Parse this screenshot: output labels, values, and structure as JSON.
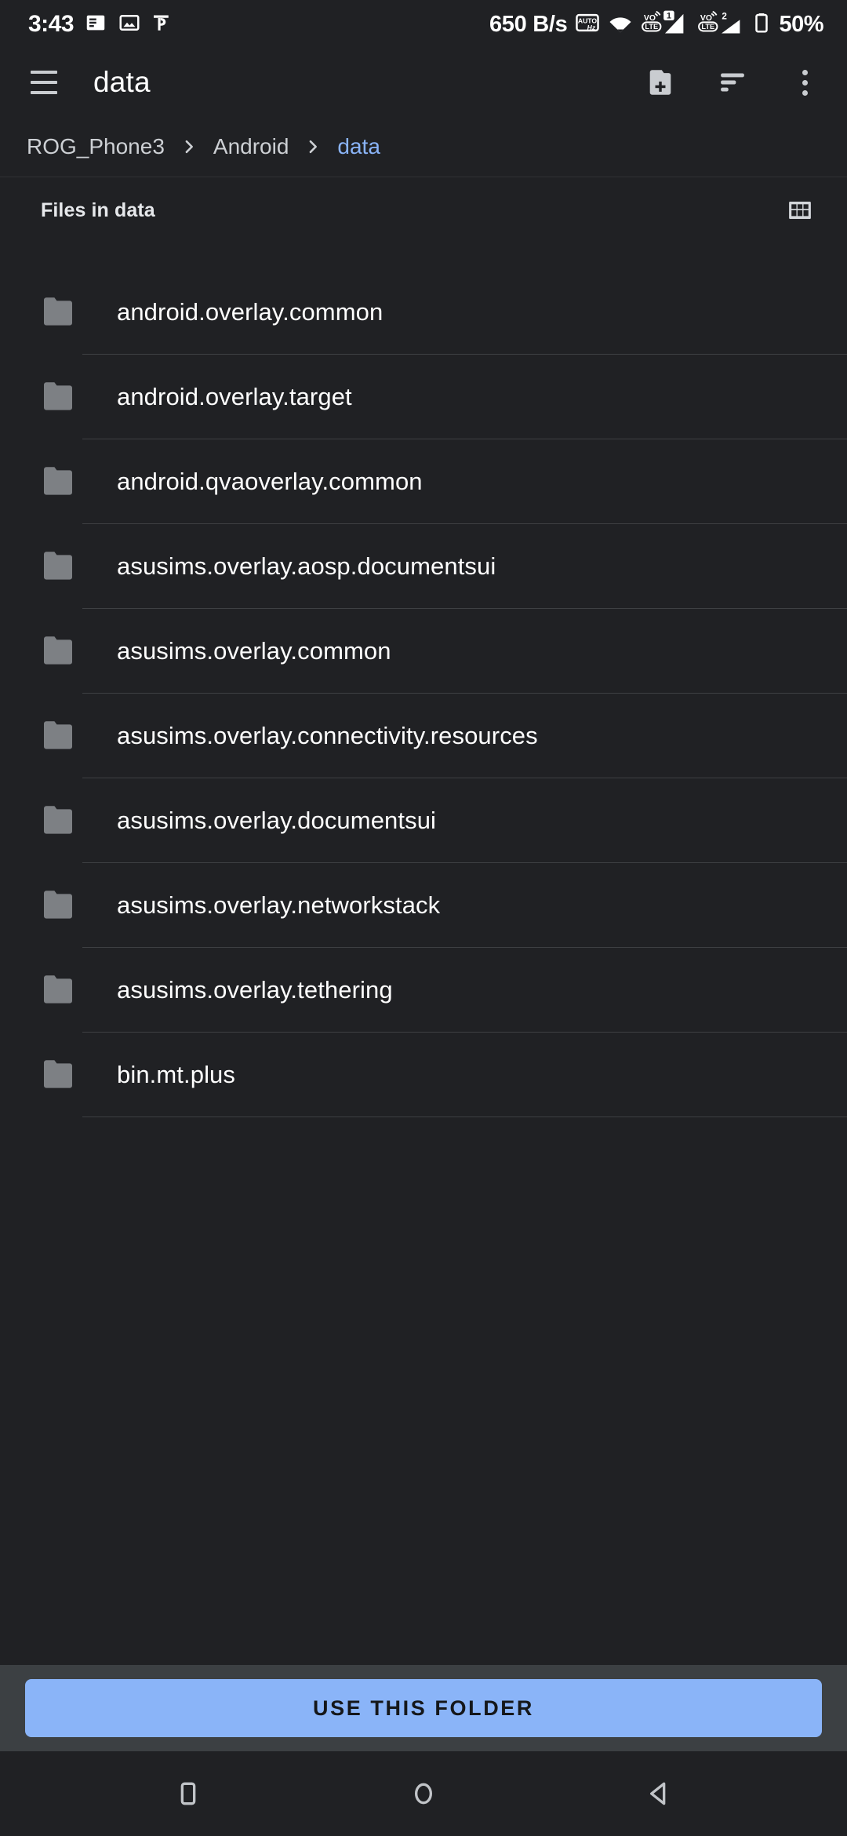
{
  "status_bar": {
    "time": "3:43",
    "left_icons": [
      "notes-icon",
      "image-icon",
      "devanagari-keyboard-icon"
    ],
    "network_rate": "650 B/s",
    "refresh_rate_icon": "auto-hz-icon",
    "wifi_icon": "wifi-icon",
    "sim1": {
      "volte_label": "VoLTE",
      "slot": "1"
    },
    "sim2": {
      "volte_label": "VoLTE",
      "slot": "2"
    },
    "battery_percent": "50%"
  },
  "toolbar": {
    "menu_icon": "hamburger-menu-icon",
    "title": "data",
    "new_folder_icon": "new-folder-icon",
    "sort_icon": "sort-icon",
    "overflow_icon": "overflow-menu-icon"
  },
  "breadcrumb": {
    "separator": "chevron-right-icon",
    "items": [
      {
        "label": "ROG_Phone3",
        "active": false
      },
      {
        "label": "Android",
        "active": false
      },
      {
        "label": "data",
        "active": true
      }
    ]
  },
  "section": {
    "title": "Files in data",
    "view_toggle_icon": "grid-view-icon"
  },
  "files": [
    {
      "name": "android.overlay.common",
      "icon": "folder-icon"
    },
    {
      "name": "android.overlay.target",
      "icon": "folder-icon"
    },
    {
      "name": "android.qvaoverlay.common",
      "icon": "folder-icon"
    },
    {
      "name": "asusims.overlay.aosp.documentsui",
      "icon": "folder-icon"
    },
    {
      "name": "asusims.overlay.common",
      "icon": "folder-icon"
    },
    {
      "name": "asusims.overlay.connectivity.resources",
      "icon": "folder-icon"
    },
    {
      "name": "asusims.overlay.documentsui",
      "icon": "folder-icon"
    },
    {
      "name": "asusims.overlay.networkstack",
      "icon": "folder-icon"
    },
    {
      "name": "asusims.overlay.tethering",
      "icon": "folder-icon"
    },
    {
      "name": "bin.mt.plus",
      "icon": "folder-icon"
    }
  ],
  "bottom_bar": {
    "use_folder_label": "USE THIS FOLDER"
  },
  "nav_bar": {
    "recents_icon": "recents-square-icon",
    "home_icon": "home-circle-icon",
    "back_icon": "back-triangle-icon"
  },
  "colors": {
    "background": "#202124",
    "accent_blue": "#8ab4f8",
    "bottom_bar": "#3c4043",
    "folder_gray": "#7d8084",
    "divider": "#3e4043"
  }
}
